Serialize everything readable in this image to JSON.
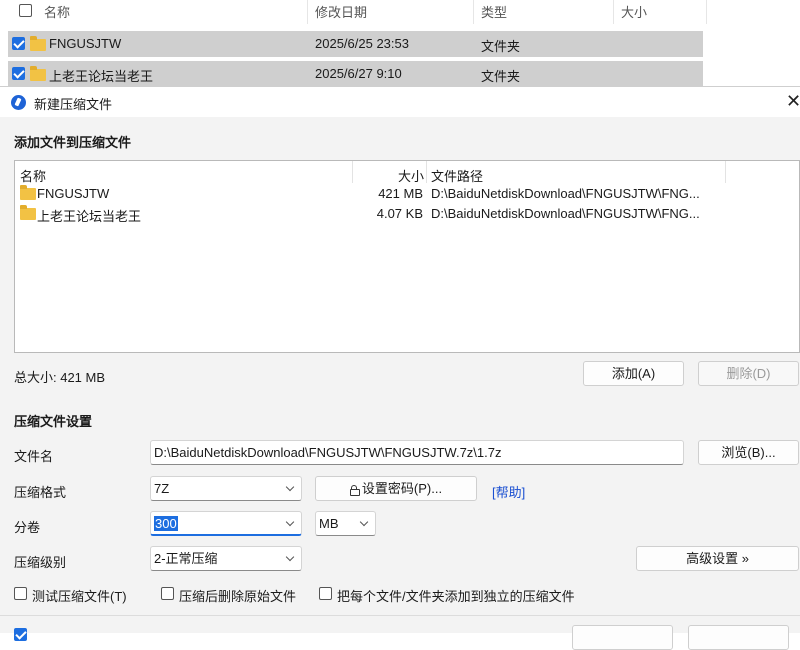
{
  "explorer": {
    "columns": {
      "name": "名称",
      "modified": "修改日期",
      "type": "类型",
      "size": "大小"
    },
    "rows": [
      {
        "name": "FNGUSJTW",
        "modified": "2025/6/25 23:53",
        "type": "文件夹"
      },
      {
        "name": "上老王论坛当老王",
        "modified": "2025/6/27 9:10",
        "type": "文件夹"
      }
    ]
  },
  "dialog": {
    "title": "新建压缩文件",
    "close": "✕",
    "add_section": "添加文件到压缩文件",
    "list": {
      "headers": {
        "name": "名称",
        "size": "大小",
        "path": "文件路径"
      },
      "rows": [
        {
          "name": "FNGUSJTW",
          "size": "421 MB",
          "path": "D:\\BaiduNetdiskDownload\\FNGUSJTW\\FNG..."
        },
        {
          "name": "上老王论坛当老王",
          "size": "4.07 KB",
          "path": "D:\\BaiduNetdiskDownload\\FNGUSJTW\\FNG..."
        }
      ]
    },
    "total_size": "总大小: 421 MB",
    "add_button": "添加(A)",
    "delete_button": "删除(D)",
    "settings_section": "压缩文件设置",
    "filename_label": "文件名",
    "filename_value": "D:\\BaiduNetdiskDownload\\FNGUSJTW\\FNGUSJTW.7z\\1.7z",
    "browse_button": "浏览(B)...",
    "format_label": "压缩格式",
    "format_value": "7Z",
    "password_button": "设置密码(P)...",
    "help_link": "[帮助]",
    "split_label": "分卷",
    "split_value": "300",
    "split_unit": "MB",
    "level_label": "压缩级别",
    "level_value": "2-正常压缩",
    "advanced_button": "高级设置 »",
    "options": {
      "test": "测试压缩文件(T)",
      "delete_after": "压缩后删除原始文件",
      "separate": "把每个文件/文件夹添加到独立的压缩文件"
    }
  }
}
